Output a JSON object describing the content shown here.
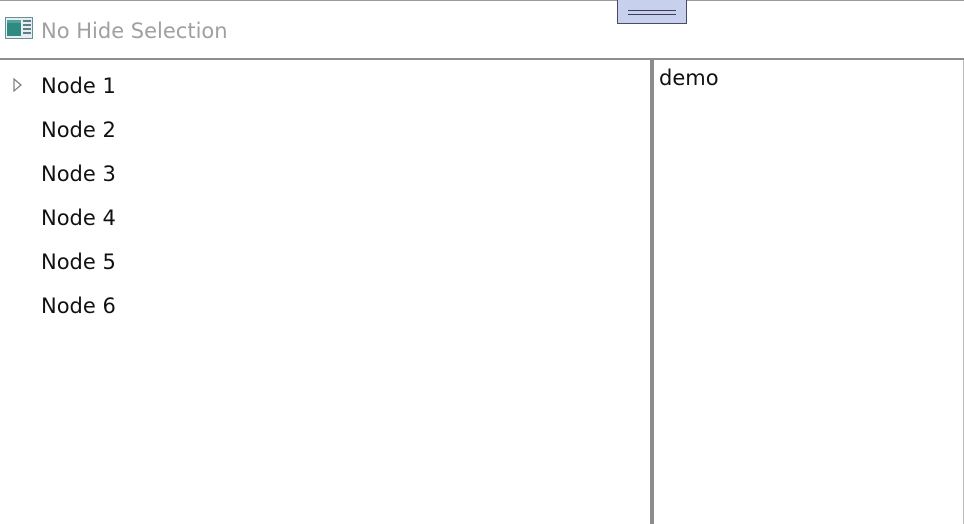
{
  "window": {
    "title": "No Hide Selection"
  },
  "tree": {
    "nodes": [
      {
        "label": "Node 1",
        "expandable": true
      },
      {
        "label": "Node 2",
        "expandable": false
      },
      {
        "label": "Node 3",
        "expandable": false
      },
      {
        "label": "Node 4",
        "expandable": false
      },
      {
        "label": "Node 5",
        "expandable": false
      },
      {
        "label": "Node 6",
        "expandable": false
      }
    ]
  },
  "detail": {
    "text": "demo"
  },
  "icons": {
    "app": "window-app-icon",
    "expander": "triangle-right-icon",
    "grip": "grip-handle-icon"
  },
  "colors": {
    "title_text": "#a0a0a0",
    "grip_fill": "#c7d1ee",
    "splitter": "#8c8c8c"
  }
}
